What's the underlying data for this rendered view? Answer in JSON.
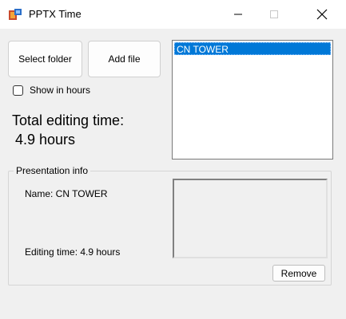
{
  "window": {
    "title": "PPTX Time",
    "app_icon": "app-icon",
    "caption_buttons": [
      "minimize-icon",
      "maximize-icon",
      "close-icon"
    ]
  },
  "toolbar": {
    "select_folder_label": "Select folder",
    "add_file_label": "Add file"
  },
  "options": {
    "show_in_hours_label": "Show in hours",
    "show_in_hours_checked": false
  },
  "summary": {
    "total_label": "Total editing time:",
    "total_value": "4.9 hours"
  },
  "file_list": {
    "items": [
      "CN TOWER"
    ],
    "selected_index": 0
  },
  "presentation_info": {
    "legend": "Presentation info",
    "name_text": "Name: CN TOWER",
    "editing_time_text": "Editing time: 4.9 hours",
    "remove_label": "Remove"
  },
  "colors": {
    "selection": "#0078d7",
    "window_bg": "#f0f0f0",
    "titlebar_bg": "#ffffff"
  }
}
